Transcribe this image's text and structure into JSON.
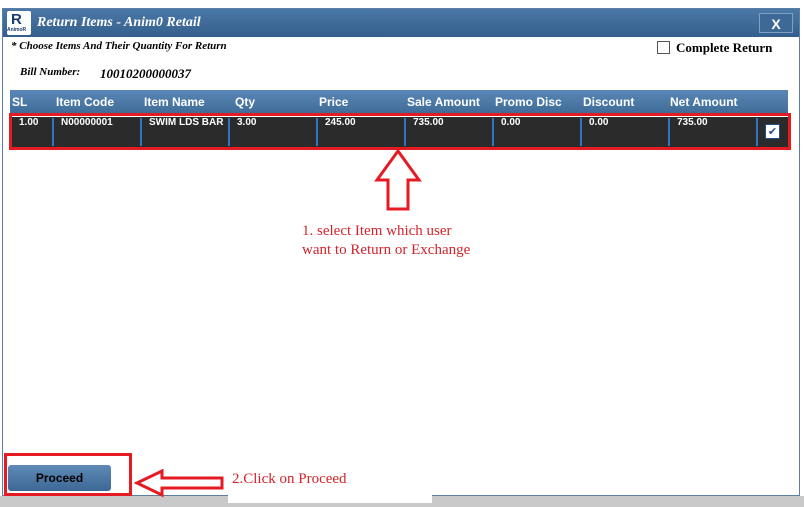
{
  "window": {
    "title": "Return Items - Anim0 Retail",
    "logo_letter": "R",
    "logo_text": "AnimoR",
    "close_label": "X"
  },
  "hint": "* Choose Items And Their Quantity For Return",
  "complete_return_label": "Complete Return",
  "bill": {
    "label": "Bill Number:",
    "value": "10010200000037"
  },
  "table": {
    "columns": [
      "SL",
      "Item Code",
      "Item Name",
      "Qty",
      "Price",
      "Sale Amount",
      "Promo Disc",
      "Discount",
      "Net Amount"
    ],
    "rows": [
      {
        "sl": "1.00",
        "item_code": "N00000001",
        "item_name": "SWIM LDS BAR",
        "qty": "3.00",
        "price": "245.00",
        "sale_amount": "735.00",
        "promo_disc": "0.00",
        "discount": "0.00",
        "net_amount": "735.00",
        "checked": true
      }
    ]
  },
  "annotations": {
    "step1_line1": "1. select Item which user",
    "step1_line2": "want to Return or Exchange",
    "step2": "2.Click on Proceed"
  },
  "proceed_label": "Proceed",
  "colors": {
    "annotation": "#e41b23",
    "header": "#4a78a6",
    "row": "#2b2b2b"
  }
}
